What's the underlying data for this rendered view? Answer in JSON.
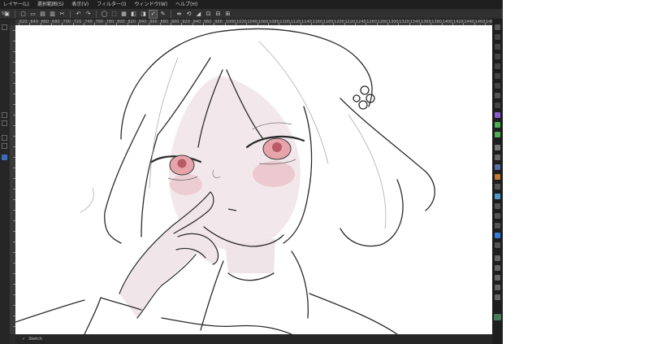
{
  "menu": {
    "items": [
      {
        "label": "レイヤー(L)"
      },
      {
        "label": "選択範囲(S)"
      },
      {
        "label": "表示(V)"
      },
      {
        "label": "フィルター(I)"
      },
      {
        "label": "ウィンドウ(W)"
      },
      {
        "label": "ヘルプ(H)"
      }
    ]
  },
  "toolbar": {
    "zoom_label": "50",
    "icons": [
      "canvas-settings-icon",
      "new-icon",
      "open-icon",
      "save-icon",
      "copy-icon",
      "cut-icon",
      "undo-icon",
      "redo-icon",
      "clear-icon",
      "transform-icon",
      "deselect-icon",
      "invert-icon",
      "fill-icon",
      "check-icon",
      "brush-icon",
      "flip-icon",
      "rotate-icon",
      "gradient-icon",
      "snap-icon",
      "ruler-icon",
      "settings-icon"
    ]
  },
  "ruler": {
    "ticks": [
      "620",
      "640",
      "660",
      "680",
      "700",
      "720",
      "740",
      "760",
      "780",
      "800",
      "820",
      "840",
      "860",
      "880",
      "900",
      "920",
      "940",
      "960",
      "980",
      "1000",
      "1020",
      "1040",
      "1060",
      "1080",
      "1100",
      "1120",
      "1140",
      "1160",
      "1180",
      "1200",
      "1220",
      "1240",
      "1260",
      "1280",
      "1300",
      "1320",
      "1340",
      "1360",
      "1380",
      "1400",
      "1420",
      "1440",
      "1460",
      "1480"
    ]
  },
  "status": {
    "text": "Sketch"
  },
  "colors": {
    "app_bg": "#2b2b2b",
    "menubar_bg": "#1f1f1f",
    "canvas_bg": "#ffffff",
    "line": "#2a2a2a",
    "skin": "#f1e6ea",
    "blush": "#e6b4ba",
    "eye": "#e7a4ab",
    "accent_green": "#4caf50",
    "accent_blue": "#2f7de1",
    "accent_purple": "#8b5cd6"
  }
}
